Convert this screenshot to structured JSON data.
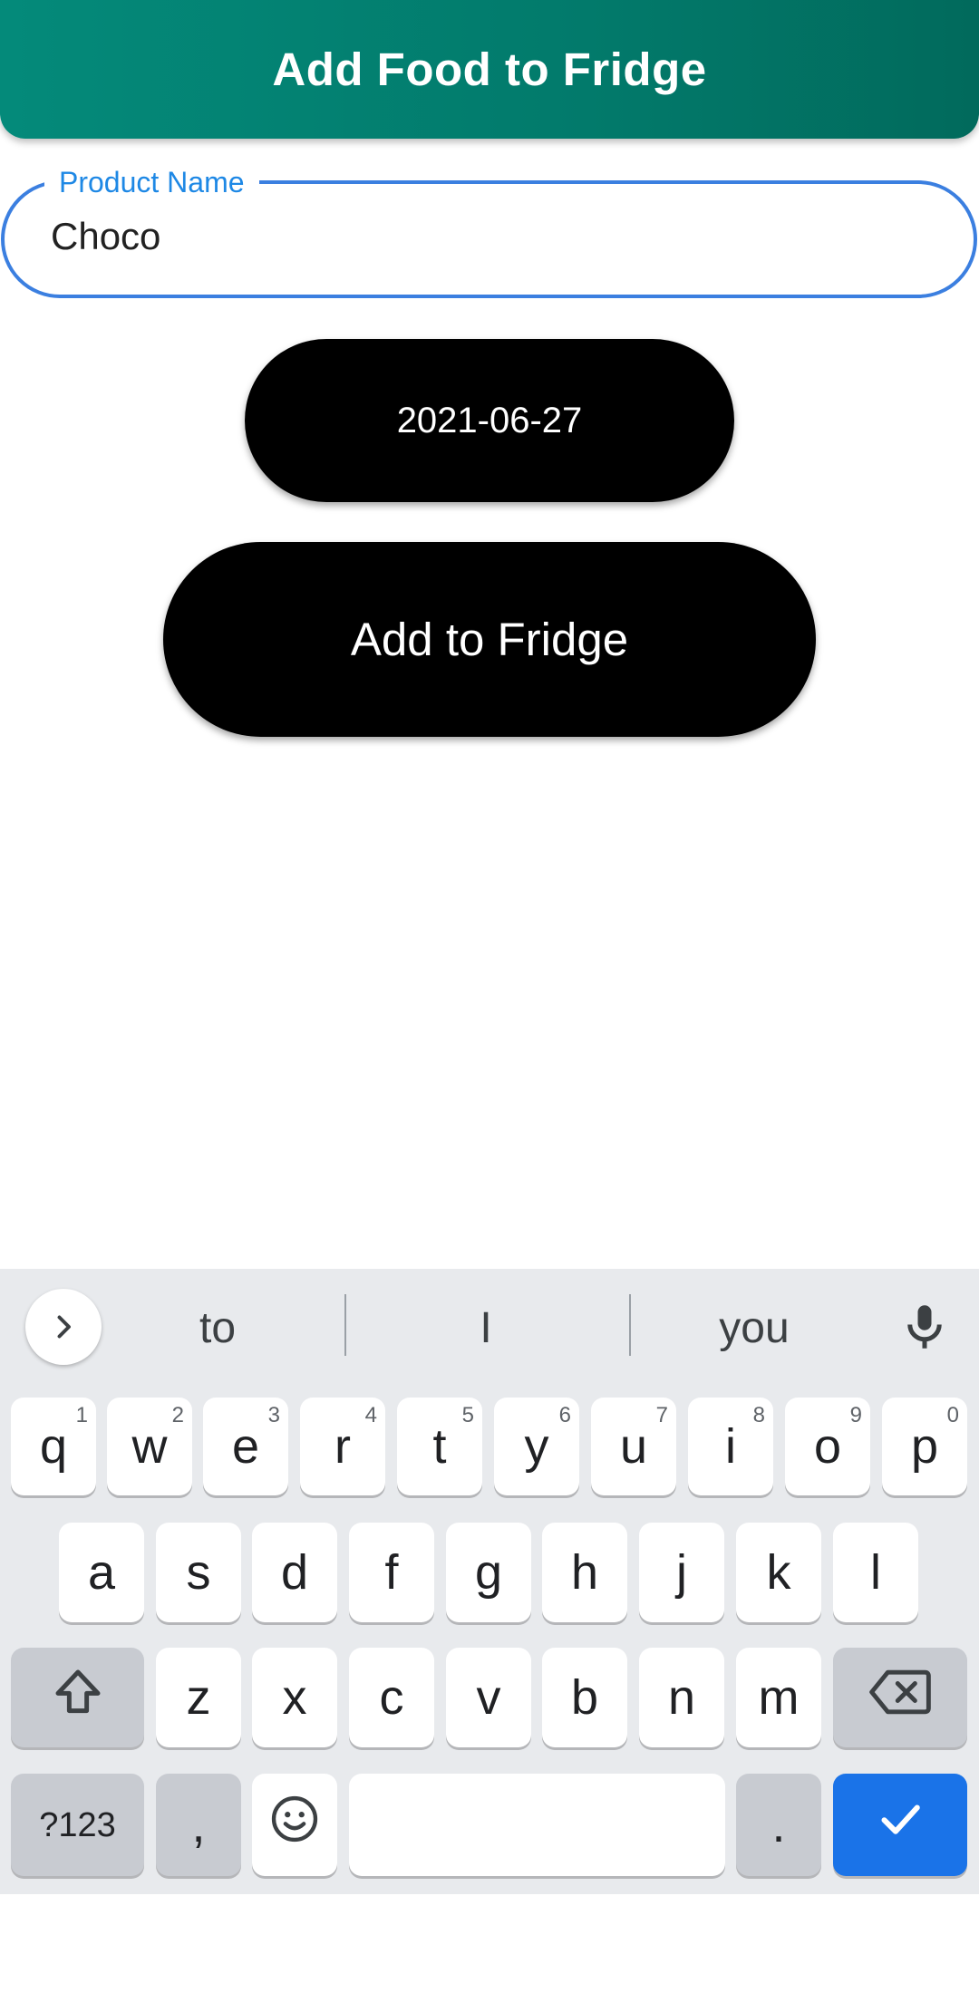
{
  "appbar": {
    "title": "Add Food to Fridge"
  },
  "product_field": {
    "label": "Product Name",
    "value": "Choco"
  },
  "date_button": {
    "label": "2021-06-27"
  },
  "add_button": {
    "label": "Add to Fridge"
  },
  "keyboard": {
    "suggestions": [
      "to",
      "I",
      "you"
    ],
    "row1": [
      {
        "key": "q",
        "hint": "1"
      },
      {
        "key": "w",
        "hint": "2"
      },
      {
        "key": "e",
        "hint": "3"
      },
      {
        "key": "r",
        "hint": "4"
      },
      {
        "key": "t",
        "hint": "5"
      },
      {
        "key": "y",
        "hint": "6"
      },
      {
        "key": "u",
        "hint": "7"
      },
      {
        "key": "i",
        "hint": "8"
      },
      {
        "key": "o",
        "hint": "9"
      },
      {
        "key": "p",
        "hint": "0"
      }
    ],
    "row2": [
      "a",
      "s",
      "d",
      "f",
      "g",
      "h",
      "j",
      "k",
      "l"
    ],
    "row3": [
      "z",
      "x",
      "c",
      "v",
      "b",
      "n",
      "m"
    ],
    "symbols_label": "?123",
    "comma": ",",
    "period": ".",
    "icons": {
      "expand": "chevron-right-icon",
      "mic": "microphone-icon",
      "shift": "shift-icon",
      "backspace": "backspace-icon",
      "emoji": "emoji-icon",
      "enter": "checkmark-icon"
    }
  },
  "colors": {
    "appbar": "#027a6b",
    "field_border": "#3b7fe0",
    "field_label": "#1e88e5",
    "enter_key": "#1a73e8"
  }
}
